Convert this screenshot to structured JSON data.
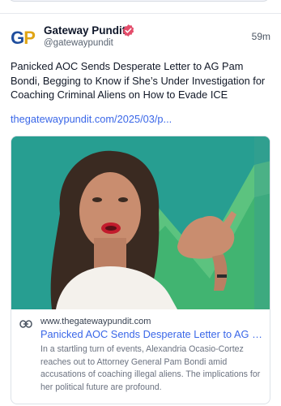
{
  "post": {
    "author_name": "Gateway Pundit",
    "author_handle": "@gatewaypundit",
    "avatar_text_a": "G",
    "avatar_text_b": "P",
    "timestamp": "59m",
    "text": "Panicked AOC Sends Desperate Letter to AG Pam Bondi, Begging to Know if She’s Under Investigation for Coaching Criminal Aliens on How to Evade ICE",
    "link_text": "thegatewaypundit.com/2025/03/p..."
  },
  "link_card": {
    "domain": "www.thegatewaypundit.com",
    "title": "Panicked AOC Sends Desperate Letter to AG P...",
    "description": "In a startling turn of events, Alexandria Ocasio-Cortez reaches out to Attorney General Pam Bondi amid accusations of coaching illegal aliens. The implications for her political future are profound."
  },
  "colors": {
    "verified_badge": "#e44d6b",
    "link": "#3a67e8",
    "avatar_blue": "#1f4e9e",
    "avatar_gold": "#e0a516",
    "image_teal": "#1f9c8e",
    "image_green": "#54c07a"
  },
  "icons": {
    "verified": "verified-badge-icon",
    "link": "link-icon"
  }
}
